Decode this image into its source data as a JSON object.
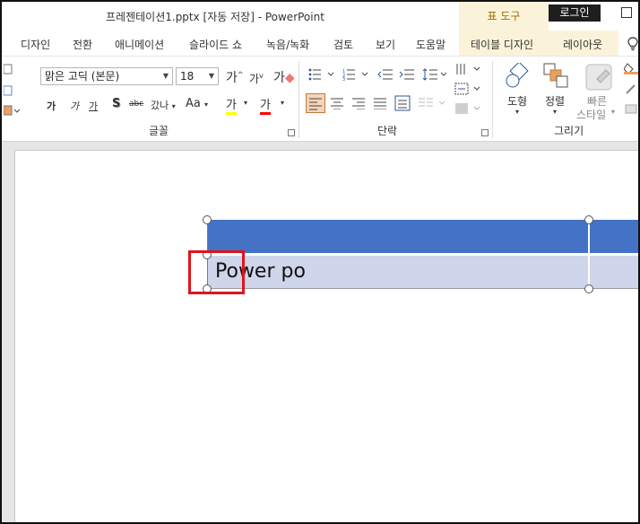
{
  "titlebar": {
    "title": "프레젠테이션1.pptx [자동 저장]  -  PowerPoint",
    "context_tab": "표 도구",
    "login_label": "로그인"
  },
  "tabs": {
    "design": "디자인",
    "transitions": "전환",
    "animations": "애니메이션",
    "slideshow": "슬라이드 쇼",
    "record": "녹음/녹화",
    "review": "검토",
    "view": "보기",
    "help": "도움말",
    "table_design": "테이블 디자인",
    "layout": "레이아웃"
  },
  "ribbon": {
    "font_name": "맑은 고딕 (본문)",
    "font_size": "18",
    "font_group_label": "글꼴",
    "paragraph_group_label": "단락",
    "drawing_group_label": "그리기",
    "shape_label": "도형",
    "arrange_label": "정렬",
    "quick_style_label_1": "빠른",
    "quick_style_label_2": "스타일",
    "grow_font": "가",
    "shrink_font": "가",
    "clear_format": "가",
    "bold": "가",
    "italic": "가",
    "underline": "가",
    "shadow": "S",
    "strike": "abc",
    "spacing": "갔나",
    "case": "Aa",
    "highlight": "가",
    "font_color": "가",
    "highlight_color": "#ffff00",
    "font_color_value": "#ff0000"
  },
  "slide": {
    "table_header_color": "#4472c4",
    "table_body_color": "#cfd5ea",
    "cell_text": "Power po",
    "annotation_color": "#e0141b"
  }
}
